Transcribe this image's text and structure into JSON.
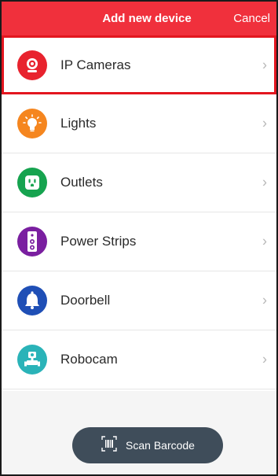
{
  "header": {
    "title": "Add new device",
    "cancel_label": "Cancel",
    "color": "#f0303c"
  },
  "devices": [
    {
      "label": "IP Cameras",
      "icon": "ip-camera-icon",
      "color": "#e8232e",
      "selected": true
    },
    {
      "label": "Lights",
      "icon": "light-bulb-icon",
      "color": "#f5861f",
      "selected": false
    },
    {
      "label": "Outlets",
      "icon": "outlet-icon",
      "color": "#16a34f",
      "selected": false
    },
    {
      "label": "Power Strips",
      "icon": "power-strip-icon",
      "color": "#7a1fa0",
      "selected": false
    },
    {
      "label": "Doorbell",
      "icon": "bell-icon",
      "color": "#1f4fb6",
      "selected": false
    },
    {
      "label": "Robocam",
      "icon": "robocam-icon",
      "color": "#2ab3b8",
      "selected": false
    }
  ],
  "scan_button": {
    "label": "Scan Barcode",
    "icon": "barcode-icon",
    "color": "#3f4d5a"
  },
  "chevron": "›"
}
